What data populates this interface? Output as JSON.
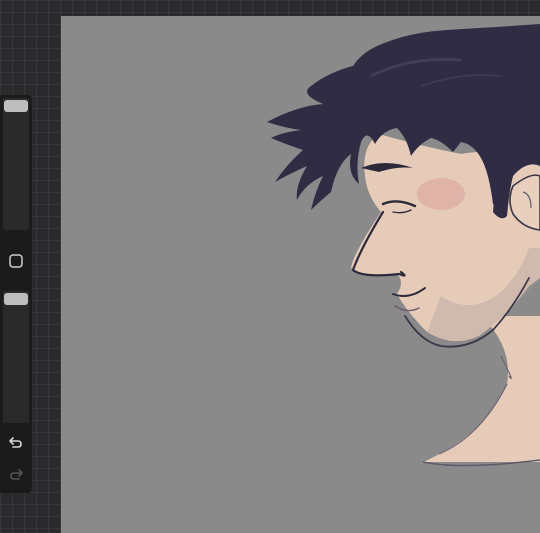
{
  "app": {
    "workspace_background": "#2a2a2c",
    "canvas_background": "#8a8a8a"
  },
  "sidebar": {
    "brush_size_slider": {
      "icon": "slider-thumb",
      "level": 1.0
    },
    "modify_button": {
      "icon": "square-outline-icon"
    },
    "opacity_slider": {
      "icon": "slider-thumb",
      "level": 1.0
    },
    "undo_button": {
      "icon": "undo-arrow-icon",
      "enabled": true
    },
    "redo_button": {
      "icon": "redo-arrow-icon",
      "enabled": false
    }
  },
  "artwork": {
    "subject": "profile-portrait",
    "hair_color": "#2f2c44",
    "skin_color": "#e7cbb9",
    "blush_color": "#dba6a0",
    "line_color": "#2b2a3a"
  }
}
